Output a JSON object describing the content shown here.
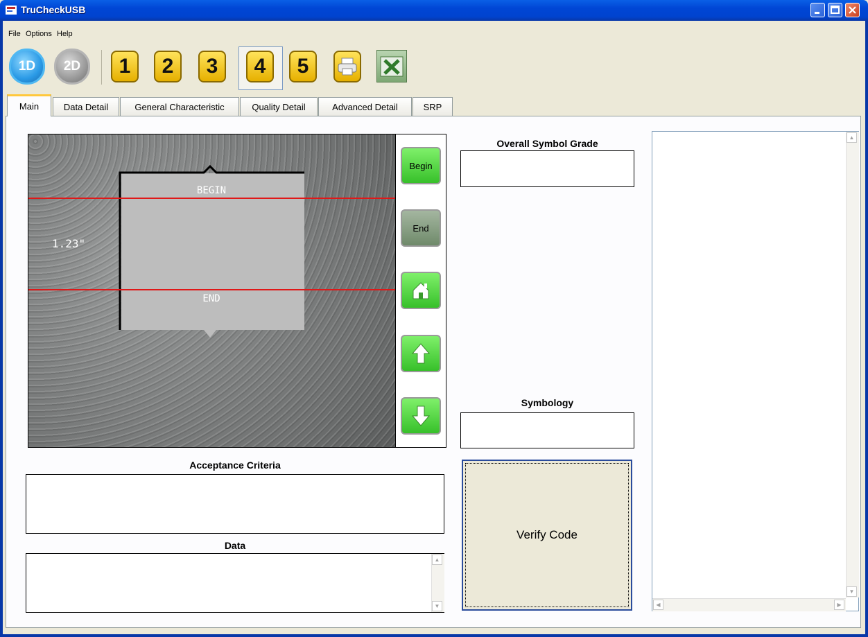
{
  "window": {
    "title": "TruCheckUSB"
  },
  "menu": {
    "items": [
      "File",
      "Options",
      "Help"
    ]
  },
  "toolbar": {
    "btn_1d": "1D",
    "btn_2d": "2D",
    "num_buttons": [
      "1",
      "2",
      "3",
      "4",
      "5"
    ],
    "selected": "4"
  },
  "tabs": [
    "Main",
    "Data Detail",
    "General Characteristic",
    "Quality Detail",
    "Advanced Detail",
    "SRP"
  ],
  "active_tab": "Main",
  "camera": {
    "begin_label": "BEGIN",
    "end_label": "END",
    "measurement": "1.23\""
  },
  "side_buttons": {
    "begin": "Begin",
    "end": "End",
    "icons": [
      "home-icon",
      "arrow-up-icon",
      "arrow-down-icon"
    ]
  },
  "overall_grade": {
    "label": "Overall Symbol Grade",
    "value": ""
  },
  "symbology": {
    "label": "Symbology",
    "value": ""
  },
  "acceptance": {
    "label": "Acceptance Criteria",
    "value": ""
  },
  "data_box": {
    "label": "Data",
    "value": ""
  },
  "verify_button": "Verify Code",
  "colors": {
    "titlebar": "#0046d5",
    "green_button": "#4cd33e",
    "marker_line": "#e01818",
    "tab_highlight": "#ffc83c"
  }
}
